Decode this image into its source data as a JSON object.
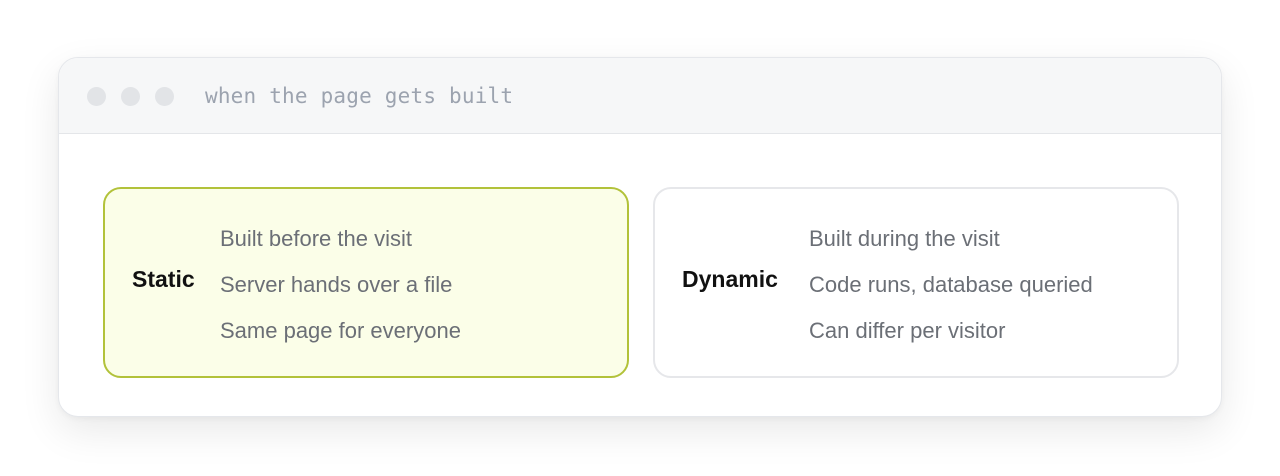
{
  "window": {
    "title": "when the page gets built"
  },
  "cards": [
    {
      "name": "Static",
      "points": [
        "Built before the visit",
        "Server hands over a file",
        "Same page for everyone"
      ]
    },
    {
      "name": "Dynamic",
      "points": [
        "Built during the visit",
        "Code runs, database queried",
        "Can differ per visitor"
      ]
    }
  ],
  "colors": {
    "static_fill": "#fbfee8",
    "static_border": "#b2c23a",
    "dynamic_border": "#e6e7ea",
    "titlebar": "#f6f7f8",
    "muted_text": "#6b6f76"
  }
}
